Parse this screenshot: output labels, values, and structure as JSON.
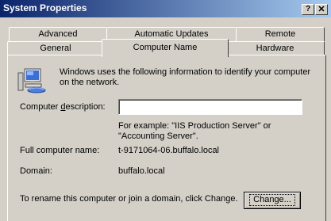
{
  "window": {
    "title": "System Properties",
    "help_glyph": "?",
    "close_glyph": "✕"
  },
  "tabs": {
    "row_back": [
      "Advanced",
      "Automatic Updates",
      "Remote"
    ],
    "row_front": [
      "General",
      "Computer Name",
      "Hardware"
    ],
    "selected": "Computer Name"
  },
  "computer_name": {
    "intro": "Windows uses the following information to identify your computer on the network.",
    "description_label": "Computer description:",
    "description_label_accesskey": "d",
    "description_value": "",
    "example_text": "For example: \"IIS Production Server\" or \"Accounting Server\".",
    "full_name_label": "Full computer name:",
    "full_name_value": "t-9171064-06.buffalo.local",
    "domain_label": "Domain:",
    "domain_value": "buffalo.local",
    "rename_text": "To rename this computer or join a domain, click Change.",
    "change_button": "Change..."
  },
  "icons": {
    "computer": "computer-network-icon"
  }
}
